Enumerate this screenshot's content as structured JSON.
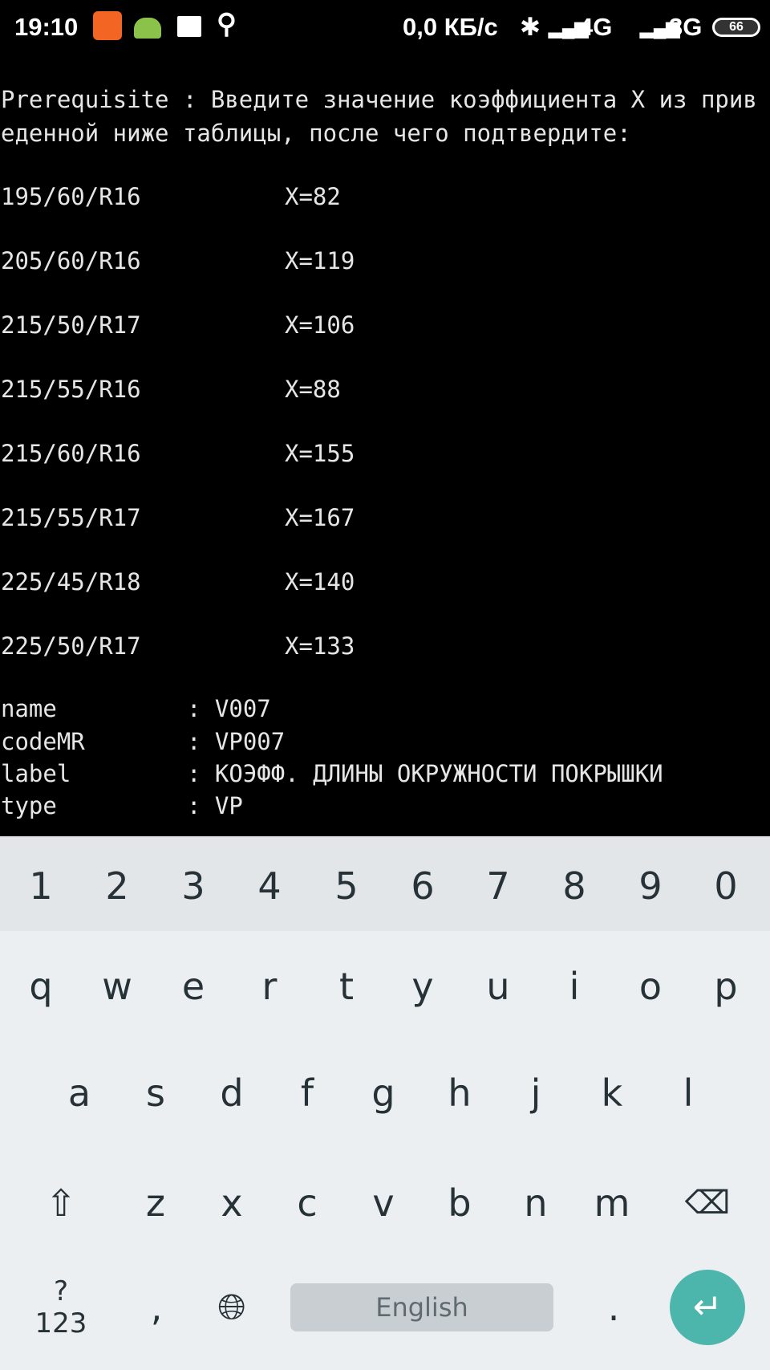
{
  "status_bar": {
    "time": "19:10",
    "net_speed": "0,0 КБ/с",
    "network1": "4G",
    "network2": "3G",
    "battery": "66",
    "icons": [
      "mi-icon",
      "android-icon",
      "clapper-icon",
      "search-icon",
      "bluetooth-icon",
      "signal-icon"
    ]
  },
  "terminal": {
    "prompt_line1": "Prerequisite : Введите значение коэффициента X из прив",
    "prompt_line2": "еденной ниже таблицы, после чего подтвердите:",
    "table": [
      {
        "size": "195/60/R16",
        "x": "X=82"
      },
      {
        "size": "205/60/R16",
        "x": "X=119"
      },
      {
        "size": "215/50/R17",
        "x": "X=106"
      },
      {
        "size": "215/55/R16",
        "x": "X=88"
      },
      {
        "size": "215/60/R16",
        "x": "X=155"
      },
      {
        "size": "215/55/R17",
        "x": "X=167"
      },
      {
        "size": "225/45/R18",
        "x": "X=140"
      },
      {
        "size": "225/50/R17",
        "x": "X=133"
      }
    ],
    "fields": [
      {
        "key": "name",
        "value": ": V007"
      },
      {
        "key": "codeMR",
        "value": ": VP007"
      },
      {
        "key": "label",
        "value": ": КОЭФФ. ДЛИНЫ ОКРУЖНОСТИ ПОКРЫШКИ"
      },
      {
        "key": "type",
        "value": ": VP"
      }
    ]
  },
  "keyboard": {
    "numbers": [
      "1",
      "2",
      "3",
      "4",
      "5",
      "6",
      "7",
      "8",
      "9",
      "0"
    ],
    "row1": [
      "q",
      "w",
      "e",
      "r",
      "t",
      "y",
      "u",
      "i",
      "o",
      "p"
    ],
    "row2": [
      "a",
      "s",
      "d",
      "f",
      "g",
      "h",
      "j",
      "k",
      "l"
    ],
    "row3": [
      "z",
      "x",
      "c",
      "v",
      "b",
      "n",
      "m"
    ],
    "symbols_label": "?123",
    "comma": ",",
    "period": ".",
    "space_label": "English",
    "accent_color": "#4db6ac"
  }
}
